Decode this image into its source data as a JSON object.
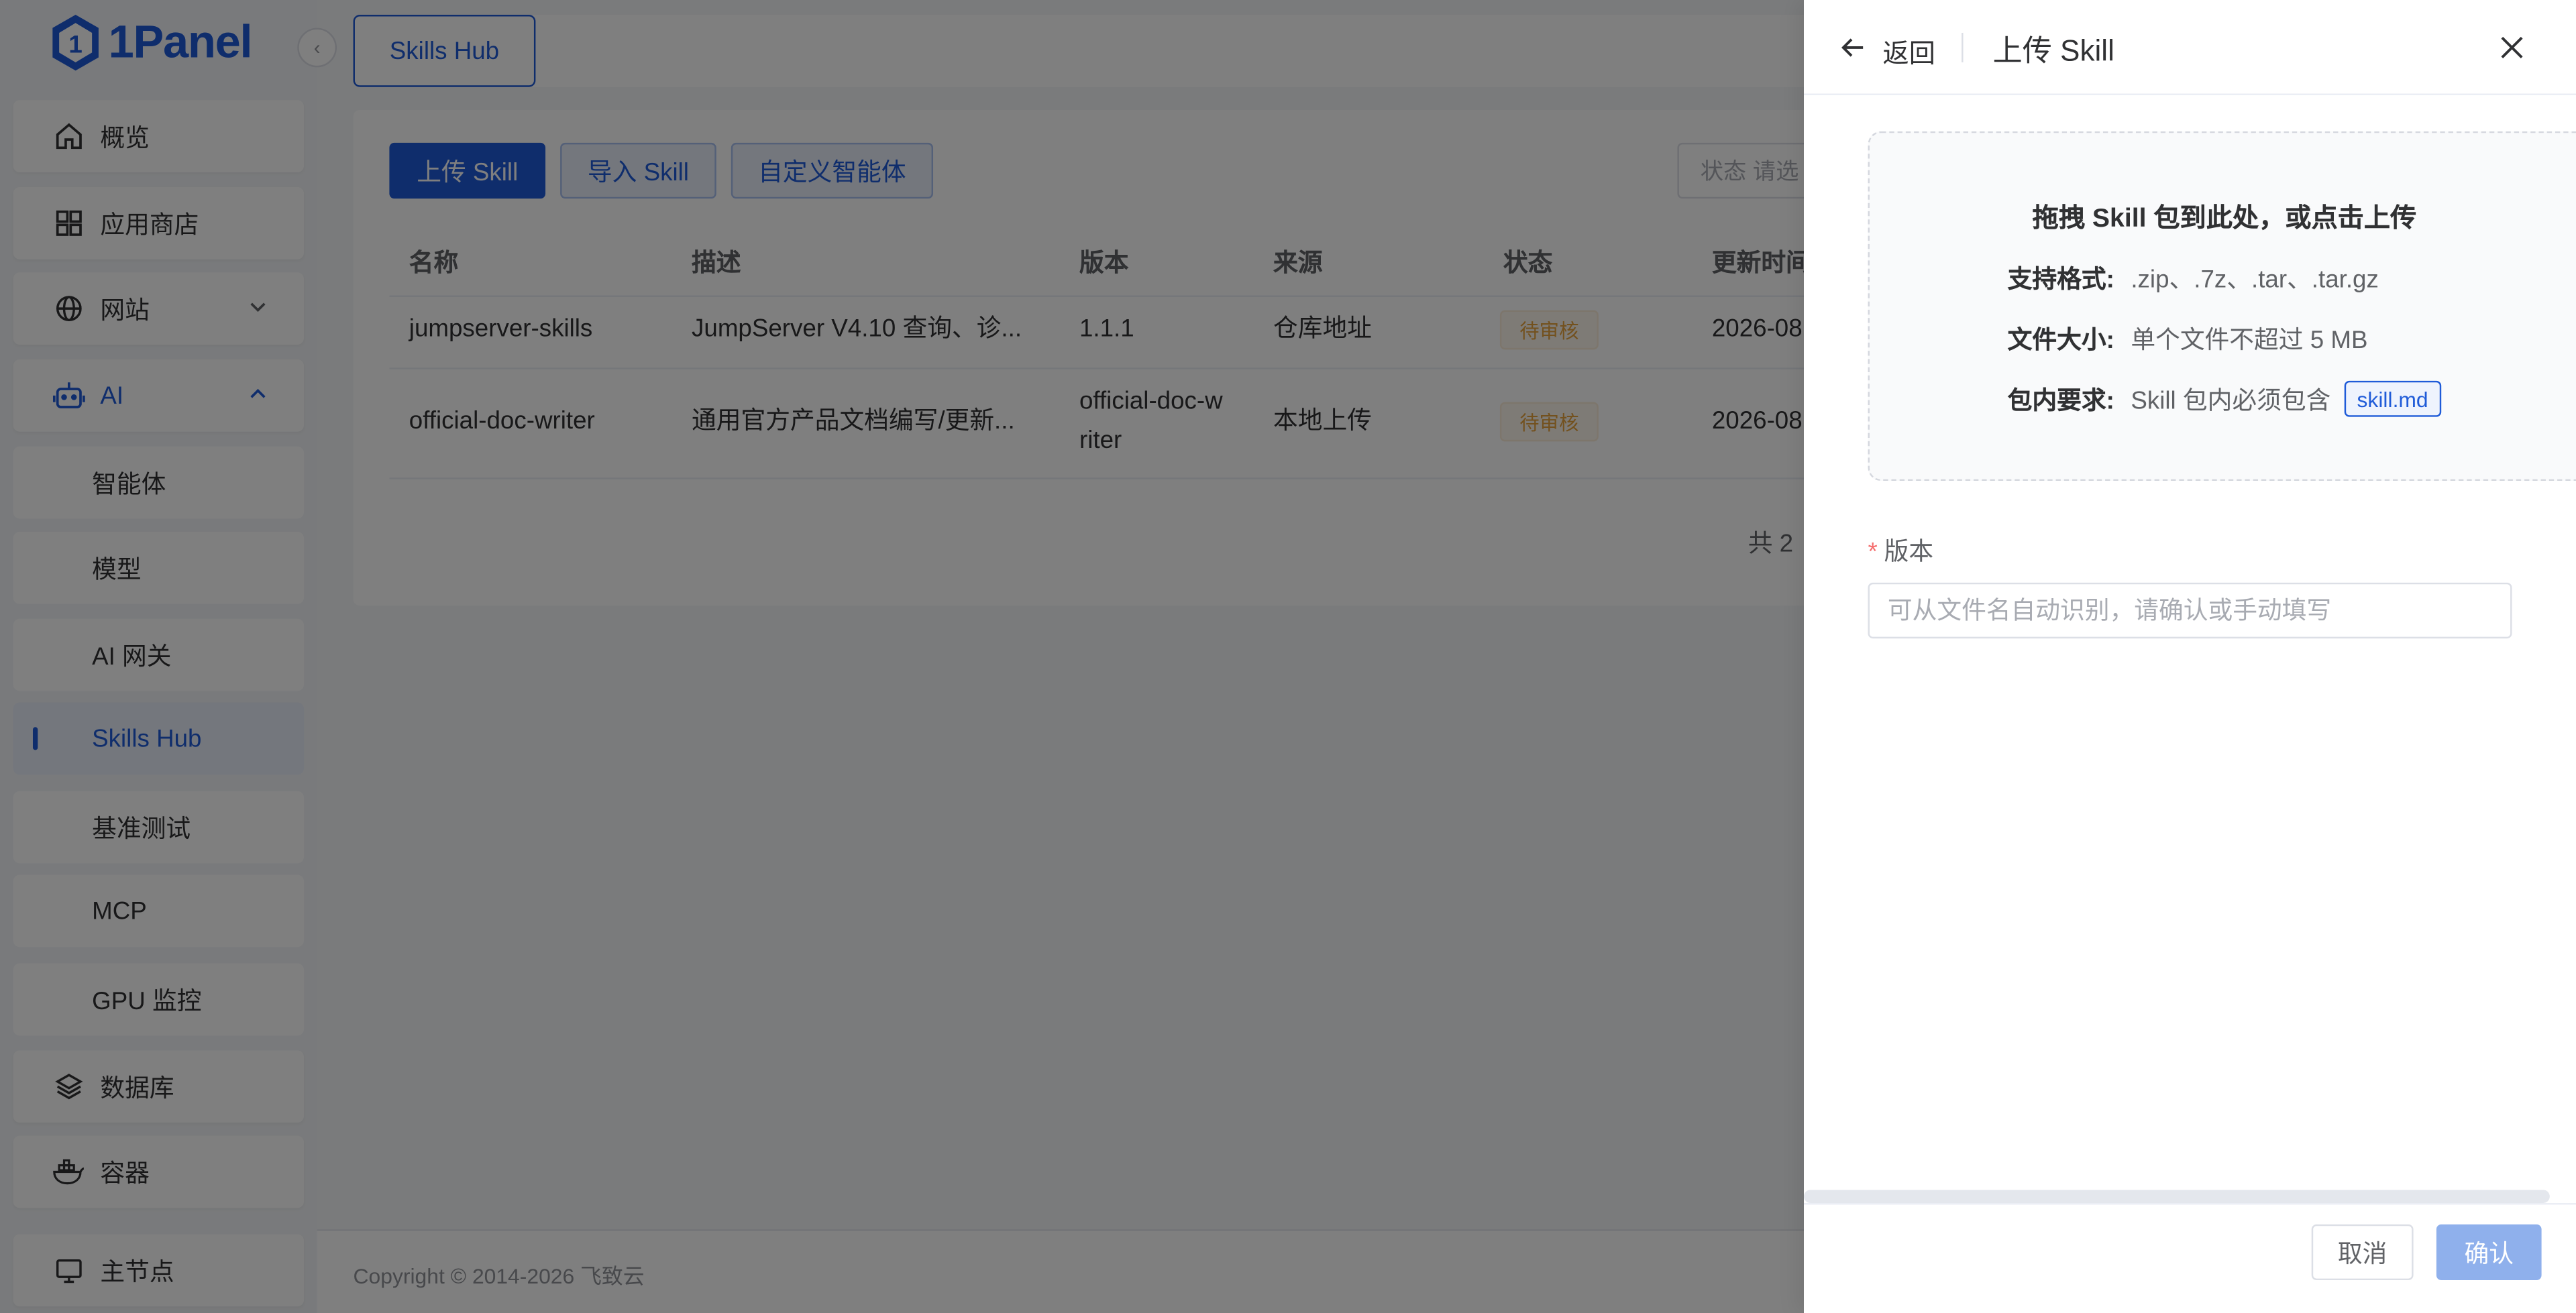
{
  "app": {
    "logo_text": "1Panel"
  },
  "sidebar": {
    "items": [
      {
        "label": "概览",
        "icon": "home-icon"
      },
      {
        "label": "应用商店",
        "icon": "grid-icon"
      },
      {
        "label": "网站",
        "icon": "globe-icon"
      },
      {
        "label": "AI",
        "icon": "robot-icon"
      },
      {
        "label": "智能体"
      },
      {
        "label": "模型"
      },
      {
        "label": "AI 网关"
      },
      {
        "label": "Skills Hub"
      },
      {
        "label": "基准测试"
      },
      {
        "label": "MCP"
      },
      {
        "label": "GPU 监控"
      },
      {
        "label": "数据库",
        "icon": "layers-icon"
      },
      {
        "label": "容器",
        "icon": "docker-icon"
      },
      {
        "label": "主节点",
        "icon": "monitor-icon"
      }
    ]
  },
  "tabs": {
    "active": "Skills Hub"
  },
  "toolbar": {
    "upload": "上传 Skill",
    "import": "导入 Skill",
    "custom_agent": "自定义智能体",
    "search_placeholder": "状态  请选"
  },
  "table": {
    "headers": [
      "名称",
      "描述",
      "版本",
      "来源",
      "状态",
      "更新时间"
    ],
    "rows": [
      {
        "name": "jumpserver-skills",
        "desc": "JumpServer V4.10 查询、诊...",
        "version": "1.1.1",
        "source": "仓库地址",
        "status": "待审核",
        "updated": "2026-08"
      },
      {
        "name": "official-doc-writer",
        "desc": "通用官方产品文档编写/更新...",
        "version": "official-doc-writer",
        "source": "本地上传",
        "status": "待审核",
        "updated": "2026-08"
      }
    ],
    "total": "共 2"
  },
  "footer": {
    "copyright": "Copyright © 2014-2026 飞致云"
  },
  "drawer": {
    "back": "返回",
    "title": "上传 Skill",
    "upload_title": "拖拽 Skill 包到此处，或点击上传",
    "formats_key": "支持格式:",
    "formats_val": ".zip、.7z、.tar、.tar.gz",
    "size_key": "文件大小:",
    "size_val": "单个文件不超过 5 MB",
    "req_key": "包内要求:",
    "req_val": "Skill 包内必须包含",
    "req_tag": "skill.md",
    "version_label": "版本",
    "version_placeholder": "可从文件名自动识别，请确认或手动填写",
    "version_value": "",
    "cancel": "取消",
    "confirm": "确认"
  },
  "colors": {
    "primary": "#1f5bd8",
    "warning": "#e6a23c",
    "confirm_disabled": "#8fb0ec"
  }
}
